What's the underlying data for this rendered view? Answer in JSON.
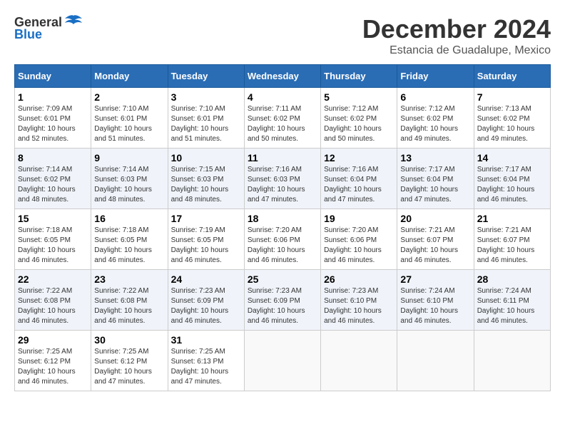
{
  "logo": {
    "general": "General",
    "blue": "Blue"
  },
  "title": {
    "month": "December 2024",
    "location": "Estancia de Guadalupe, Mexico"
  },
  "weekdays": [
    "Sunday",
    "Monday",
    "Tuesday",
    "Wednesday",
    "Thursday",
    "Friday",
    "Saturday"
  ],
  "weeks": [
    [
      {
        "day": "1",
        "sunrise": "7:09 AM",
        "sunset": "6:01 PM",
        "daylight": "10 hours and 52 minutes."
      },
      {
        "day": "2",
        "sunrise": "7:10 AM",
        "sunset": "6:01 PM",
        "daylight": "10 hours and 51 minutes."
      },
      {
        "day": "3",
        "sunrise": "7:10 AM",
        "sunset": "6:01 PM",
        "daylight": "10 hours and 51 minutes."
      },
      {
        "day": "4",
        "sunrise": "7:11 AM",
        "sunset": "6:02 PM",
        "daylight": "10 hours and 50 minutes."
      },
      {
        "day": "5",
        "sunrise": "7:12 AM",
        "sunset": "6:02 PM",
        "daylight": "10 hours and 50 minutes."
      },
      {
        "day": "6",
        "sunrise": "7:12 AM",
        "sunset": "6:02 PM",
        "daylight": "10 hours and 49 minutes."
      },
      {
        "day": "7",
        "sunrise": "7:13 AM",
        "sunset": "6:02 PM",
        "daylight": "10 hours and 49 minutes."
      }
    ],
    [
      {
        "day": "8",
        "sunrise": "7:14 AM",
        "sunset": "6:02 PM",
        "daylight": "10 hours and 48 minutes."
      },
      {
        "day": "9",
        "sunrise": "7:14 AM",
        "sunset": "6:03 PM",
        "daylight": "10 hours and 48 minutes."
      },
      {
        "day": "10",
        "sunrise": "7:15 AM",
        "sunset": "6:03 PM",
        "daylight": "10 hours and 48 minutes."
      },
      {
        "day": "11",
        "sunrise": "7:16 AM",
        "sunset": "6:03 PM",
        "daylight": "10 hours and 47 minutes."
      },
      {
        "day": "12",
        "sunrise": "7:16 AM",
        "sunset": "6:04 PM",
        "daylight": "10 hours and 47 minutes."
      },
      {
        "day": "13",
        "sunrise": "7:17 AM",
        "sunset": "6:04 PM",
        "daylight": "10 hours and 47 minutes."
      },
      {
        "day": "14",
        "sunrise": "7:17 AM",
        "sunset": "6:04 PM",
        "daylight": "10 hours and 46 minutes."
      }
    ],
    [
      {
        "day": "15",
        "sunrise": "7:18 AM",
        "sunset": "6:05 PM",
        "daylight": "10 hours and 46 minutes."
      },
      {
        "day": "16",
        "sunrise": "7:18 AM",
        "sunset": "6:05 PM",
        "daylight": "10 hours and 46 minutes."
      },
      {
        "day": "17",
        "sunrise": "7:19 AM",
        "sunset": "6:05 PM",
        "daylight": "10 hours and 46 minutes."
      },
      {
        "day": "18",
        "sunrise": "7:20 AM",
        "sunset": "6:06 PM",
        "daylight": "10 hours and 46 minutes."
      },
      {
        "day": "19",
        "sunrise": "7:20 AM",
        "sunset": "6:06 PM",
        "daylight": "10 hours and 46 minutes."
      },
      {
        "day": "20",
        "sunrise": "7:21 AM",
        "sunset": "6:07 PM",
        "daylight": "10 hours and 46 minutes."
      },
      {
        "day": "21",
        "sunrise": "7:21 AM",
        "sunset": "6:07 PM",
        "daylight": "10 hours and 46 minutes."
      }
    ],
    [
      {
        "day": "22",
        "sunrise": "7:22 AM",
        "sunset": "6:08 PM",
        "daylight": "10 hours and 46 minutes."
      },
      {
        "day": "23",
        "sunrise": "7:22 AM",
        "sunset": "6:08 PM",
        "daylight": "10 hours and 46 minutes."
      },
      {
        "day": "24",
        "sunrise": "7:23 AM",
        "sunset": "6:09 PM",
        "daylight": "10 hours and 46 minutes."
      },
      {
        "day": "25",
        "sunrise": "7:23 AM",
        "sunset": "6:09 PM",
        "daylight": "10 hours and 46 minutes."
      },
      {
        "day": "26",
        "sunrise": "7:23 AM",
        "sunset": "6:10 PM",
        "daylight": "10 hours and 46 minutes."
      },
      {
        "day": "27",
        "sunrise": "7:24 AM",
        "sunset": "6:10 PM",
        "daylight": "10 hours and 46 minutes."
      },
      {
        "day": "28",
        "sunrise": "7:24 AM",
        "sunset": "6:11 PM",
        "daylight": "10 hours and 46 minutes."
      }
    ],
    [
      {
        "day": "29",
        "sunrise": "7:25 AM",
        "sunset": "6:12 PM",
        "daylight": "10 hours and 46 minutes."
      },
      {
        "day": "30",
        "sunrise": "7:25 AM",
        "sunset": "6:12 PM",
        "daylight": "10 hours and 47 minutes."
      },
      {
        "day": "31",
        "sunrise": "7:25 AM",
        "sunset": "6:13 PM",
        "daylight": "10 hours and 47 minutes."
      },
      null,
      null,
      null,
      null
    ]
  ],
  "labels": {
    "sunrise": "Sunrise:",
    "sunset": "Sunset:",
    "daylight": "Daylight:"
  }
}
